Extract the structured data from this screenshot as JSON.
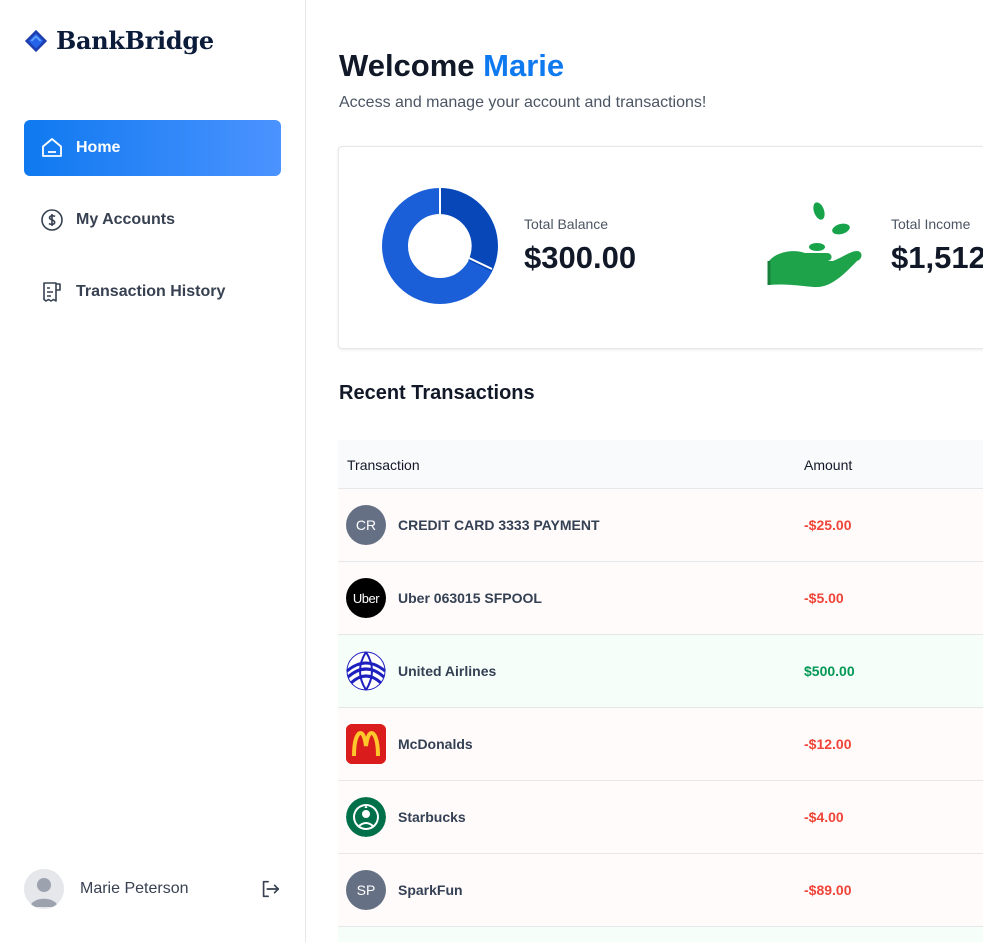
{
  "brand": {
    "name": "BankBridge"
  },
  "sidebar": {
    "items": [
      {
        "label": "Home",
        "icon": "home-icon",
        "active": true
      },
      {
        "label": "My Accounts",
        "icon": "dollar-circle-icon",
        "active": false
      },
      {
        "label": "Transaction History",
        "icon": "receipt-icon",
        "active": false
      }
    ],
    "user": {
      "name": "Marie Peterson"
    }
  },
  "header": {
    "greeting": "Welcome",
    "user_first_name": "Marie",
    "subtitle": "Access and manage your account and transactions!"
  },
  "summary": {
    "balance_label": "Total Balance",
    "balance_value": "$300.00",
    "income_label": "Total Income",
    "income_value": "$1,512"
  },
  "transactions": {
    "title": "Recent Transactions",
    "columns": [
      "Transaction",
      "Amount"
    ],
    "rows": [
      {
        "name": "CREDIT CARD 3333 PAYMENT",
        "amount": "-$25.00",
        "logo": "CR",
        "type": "debit"
      },
      {
        "name": "Uber 063015 SFPOOL",
        "amount": "-$5.00",
        "logo": "Uber",
        "type": "debit"
      },
      {
        "name": "United Airlines",
        "amount": "$500.00",
        "logo": "united-globe-icon",
        "type": "credit"
      },
      {
        "name": "McDonalds",
        "amount": "-$12.00",
        "logo": "mcdonalds-arches-icon",
        "type": "debit"
      },
      {
        "name": "Starbucks",
        "amount": "-$4.00",
        "logo": "starbucks-siren-icon",
        "type": "debit"
      },
      {
        "name": "SparkFun",
        "amount": "-$89.00",
        "logo": "SP",
        "type": "debit"
      }
    ]
  },
  "colors": {
    "accent": "#0f79f0",
    "negative": "#f04438",
    "positive": "#039855"
  }
}
